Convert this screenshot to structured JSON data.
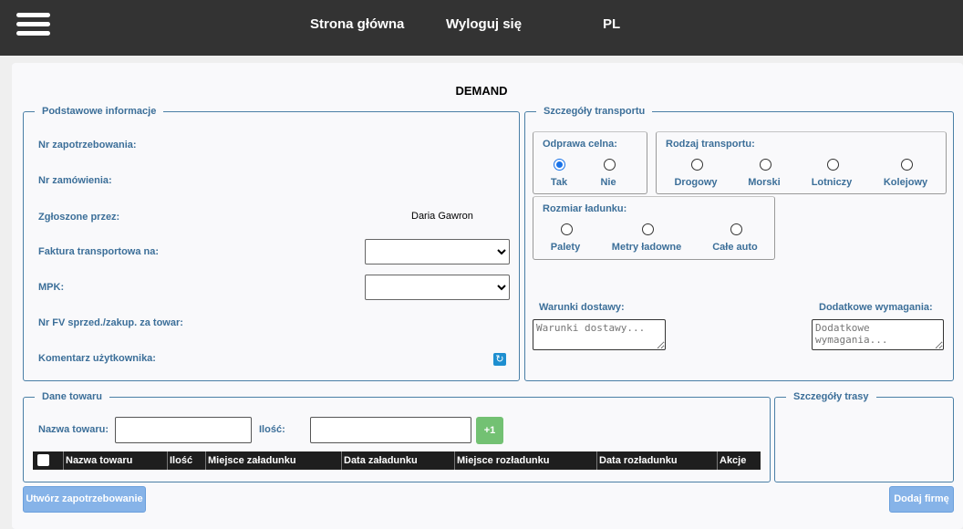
{
  "nav": {
    "home": "Strona główna",
    "logout": "Wyloguj się",
    "lang": "PL"
  },
  "page": {
    "title": "DEMAND"
  },
  "basic_info": {
    "legend": "Podstawowe informacje",
    "demand_no_label": "Nr zapotrzebowania:",
    "order_no_label": "Nr zamówienia:",
    "reported_by_label": "Zgłoszone przez:",
    "reported_by_value": "Daria Gawron",
    "transport_invoice_label": "Faktura transportowa na:",
    "mpk_label": "MPK:",
    "fv_label": "Nr FV sprzed./zakup. za towar:",
    "comment_label": "Komentarz użytkownika:"
  },
  "transport": {
    "legend": "Szczegóły transportu",
    "customs": {
      "label": "Odprawa celna:",
      "options": [
        "Tak",
        "Nie"
      ],
      "selected": "Tak"
    },
    "transport_type": {
      "label": "Rodzaj transportu:",
      "options": [
        "Drogowy",
        "Morski",
        "Lotniczy",
        "Kolejowy"
      ]
    },
    "cargo_size": {
      "label": "Rozmiar ładunku:",
      "options": [
        "Palety",
        "Metry ładowne",
        "Całe auto"
      ]
    },
    "delivery_terms": {
      "label": "Warunki dostawy:",
      "placeholder": "Warunki dostawy..."
    },
    "extra_requirements": {
      "label": "Dodatkowe wymagania:",
      "placeholder": "Dodatkowe wymagania..."
    }
  },
  "goods": {
    "legend": "Dane towaru",
    "name_label": "Nazwa towaru:",
    "qty_label": "Ilość:",
    "add_button": "+1",
    "columns": [
      "Nazwa towaru",
      "Ilość",
      "Miejsce załadunku",
      "Data załadunku",
      "Miejsce rozładunku",
      "Data rozładunku",
      "Akcje"
    ]
  },
  "route": {
    "legend": "Szczegóły trasy"
  },
  "actions": {
    "create": "Utwórz zapotrzebowanie",
    "add_company": "Dodaj firmę"
  }
}
